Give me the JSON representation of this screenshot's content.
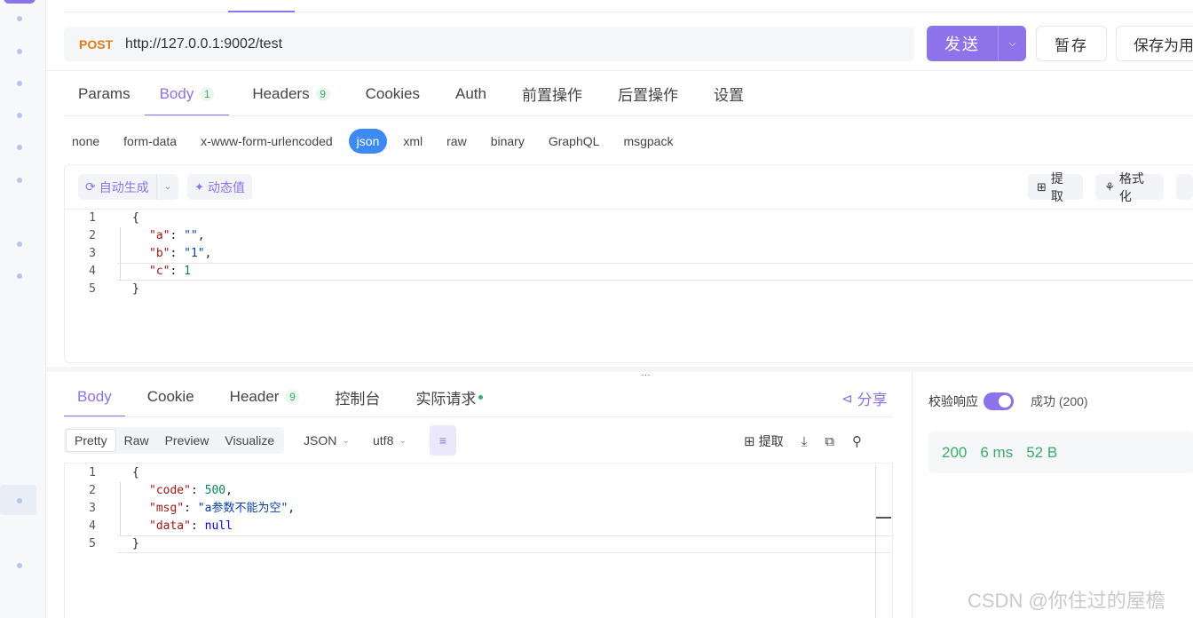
{
  "request": {
    "method": "POST",
    "url": "http://127.0.0.1:9002/test",
    "send_label": "发送",
    "save_temp_label": "暂存",
    "save_as_label": "保存为用"
  },
  "req_tabs": [
    {
      "label": "Params"
    },
    {
      "label": "Body",
      "badge": "1"
    },
    {
      "label": "Headers",
      "badge": "9"
    },
    {
      "label": "Cookies"
    },
    {
      "label": "Auth"
    },
    {
      "label": "前置操作"
    },
    {
      "label": "后置操作"
    },
    {
      "label": "设置"
    }
  ],
  "body_types": [
    "none",
    "form-data",
    "x-www-form-urlencoded",
    "json",
    "xml",
    "raw",
    "binary",
    "GraphQL",
    "msgpack"
  ],
  "editor_toolbar": {
    "auto_generate": "自动生成",
    "dynamic_value": "动态值",
    "extract": "提取",
    "format": "格式化"
  },
  "request_body_lines": [
    {
      "no": "1",
      "text": "{"
    },
    {
      "no": "2",
      "key": "\"a\"",
      "sep": ": ",
      "val": "\"\"",
      "tail": ","
    },
    {
      "no": "3",
      "key": "\"b\"",
      "sep": ": ",
      "val": "\"1\"",
      "tail": ","
    },
    {
      "no": "4",
      "key": "\"c\"",
      "sep": ": ",
      "num": "1",
      "tail": ""
    },
    {
      "no": "5",
      "text": "}"
    }
  ],
  "resp_tabs": [
    {
      "label": "Body"
    },
    {
      "label": "Cookie"
    },
    {
      "label": "Header",
      "badge": "9"
    },
    {
      "label": "控制台"
    },
    {
      "label": "实际请求"
    }
  ],
  "share_label": "分享",
  "view_modes": [
    "Pretty",
    "Raw",
    "Preview",
    "Visualize"
  ],
  "format_select": "JSON",
  "encoding_select": "utf8",
  "resp_extract": "提取",
  "response_body_lines": [
    {
      "no": "1",
      "text": "{"
    },
    {
      "no": "2",
      "key": "\"code\"",
      "sep": ": ",
      "num": "500",
      "tail": ","
    },
    {
      "no": "3",
      "key": "\"msg\"",
      "sep": ": ",
      "val": "\"a参数不能为空\"",
      "tail": ","
    },
    {
      "no": "4",
      "key": "\"data\"",
      "sep": ": ",
      "kw": "null",
      "tail": ""
    },
    {
      "no": "5",
      "text": "}"
    }
  ],
  "verify": {
    "label": "校验响应",
    "enabled": true,
    "status": "成功 (200)"
  },
  "stats": {
    "code": "200",
    "time": "6 ms",
    "size": "52 B"
  },
  "watermark": "CSDN @你住过的屋檐",
  "colors": {
    "accent": "#8c73ea",
    "method": "#e07b1a",
    "success": "#3caa6a",
    "json_active": "#3d8af7"
  },
  "icons": [
    "refresh-icon",
    "chevron-down-icon",
    "wand-icon",
    "extract-icon",
    "format-icon",
    "share-icon",
    "wrap-icon",
    "download-icon",
    "copy-icon",
    "search-icon"
  ]
}
